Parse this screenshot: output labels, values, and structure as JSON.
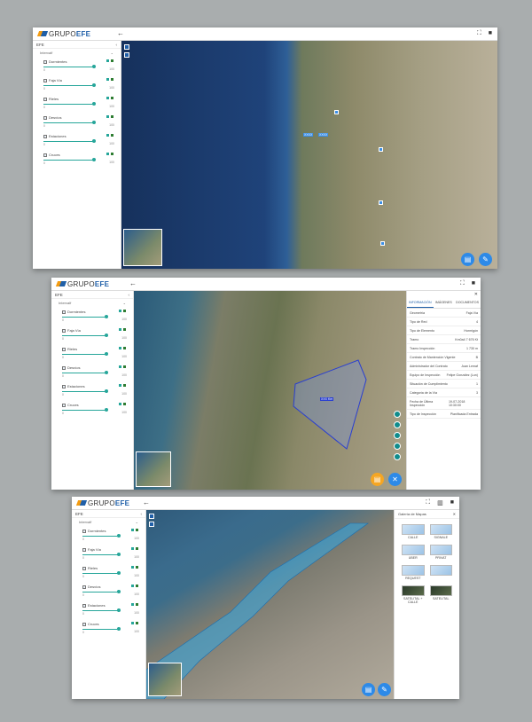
{
  "brand": {
    "text_a": "GRUPO",
    "text_b": "EFE"
  },
  "sidebar": {
    "title": "EFE",
    "group": "Intervalf",
    "layers": [
      {
        "label": "Dormientes",
        "icon": "sleepers-icon",
        "min": "0",
        "value": "100"
      },
      {
        "label": "Faja Vía",
        "icon": "track-strip-icon",
        "min": "0",
        "value": "100"
      },
      {
        "label": "Rieles",
        "icon": "rails-icon",
        "min": "0",
        "value": "100"
      },
      {
        "label": "Desvíos",
        "icon": "switch-icon",
        "min": "0",
        "value": "100"
      },
      {
        "label": "Estaciones",
        "icon": "station-icon",
        "min": "0",
        "value": "100"
      },
      {
        "label": "Cruces",
        "icon": "crossing-icon",
        "min": "0",
        "value": "100"
      }
    ]
  },
  "screens": [
    {
      "id": "s1",
      "labels": [
        "XXXX",
        "XXXX"
      ]
    },
    {
      "id": "s2",
      "label": "XXX Km",
      "info": {
        "tabs": [
          "INFORMACIÓN",
          "IMÁGENES",
          "DOCUMENTOS"
        ],
        "rows": [
          [
            "Geometría",
            "Faja Vía"
          ],
          [
            "Tipo de Red",
            "4"
          ],
          [
            "Tipo de Elemento",
            "Hormigón"
          ],
          [
            "Tramo",
            "Km0a4 7 676 Kt"
          ],
          [
            "Tramo Inspección",
            "1 730 m"
          ],
          [
            "Contrato de Mantención Vigente",
            "B"
          ],
          [
            "Administrador del Contrato",
            "Juan Lemaf"
          ],
          [
            "Equipo de Inspección",
            "Felipe González (Lun)"
          ],
          [
            "Situación de Cumplimiento",
            "1"
          ],
          [
            "Categoría de la Vía",
            "3"
          ],
          [
            "Fecha de Última Inspección",
            "19-07-2018 10:30:00"
          ],
          [
            "Tipo de Inspección",
            "Planificada Entrada"
          ]
        ]
      }
    },
    {
      "id": "s3",
      "gallery": {
        "title": "Galería de Mapas",
        "items": [
          "CALLE",
          "SIGNALE",
          "UBER",
          "PRIVAT",
          "REQUEST",
          "",
          "SATELITAL +\nCALLE",
          "SATELITAL"
        ]
      }
    }
  ],
  "colors": {
    "accent": "#1f5fa8",
    "teal": "#26a69a",
    "fab_orange": "#f5a623",
    "fab_blue": "#2d8ae8"
  }
}
